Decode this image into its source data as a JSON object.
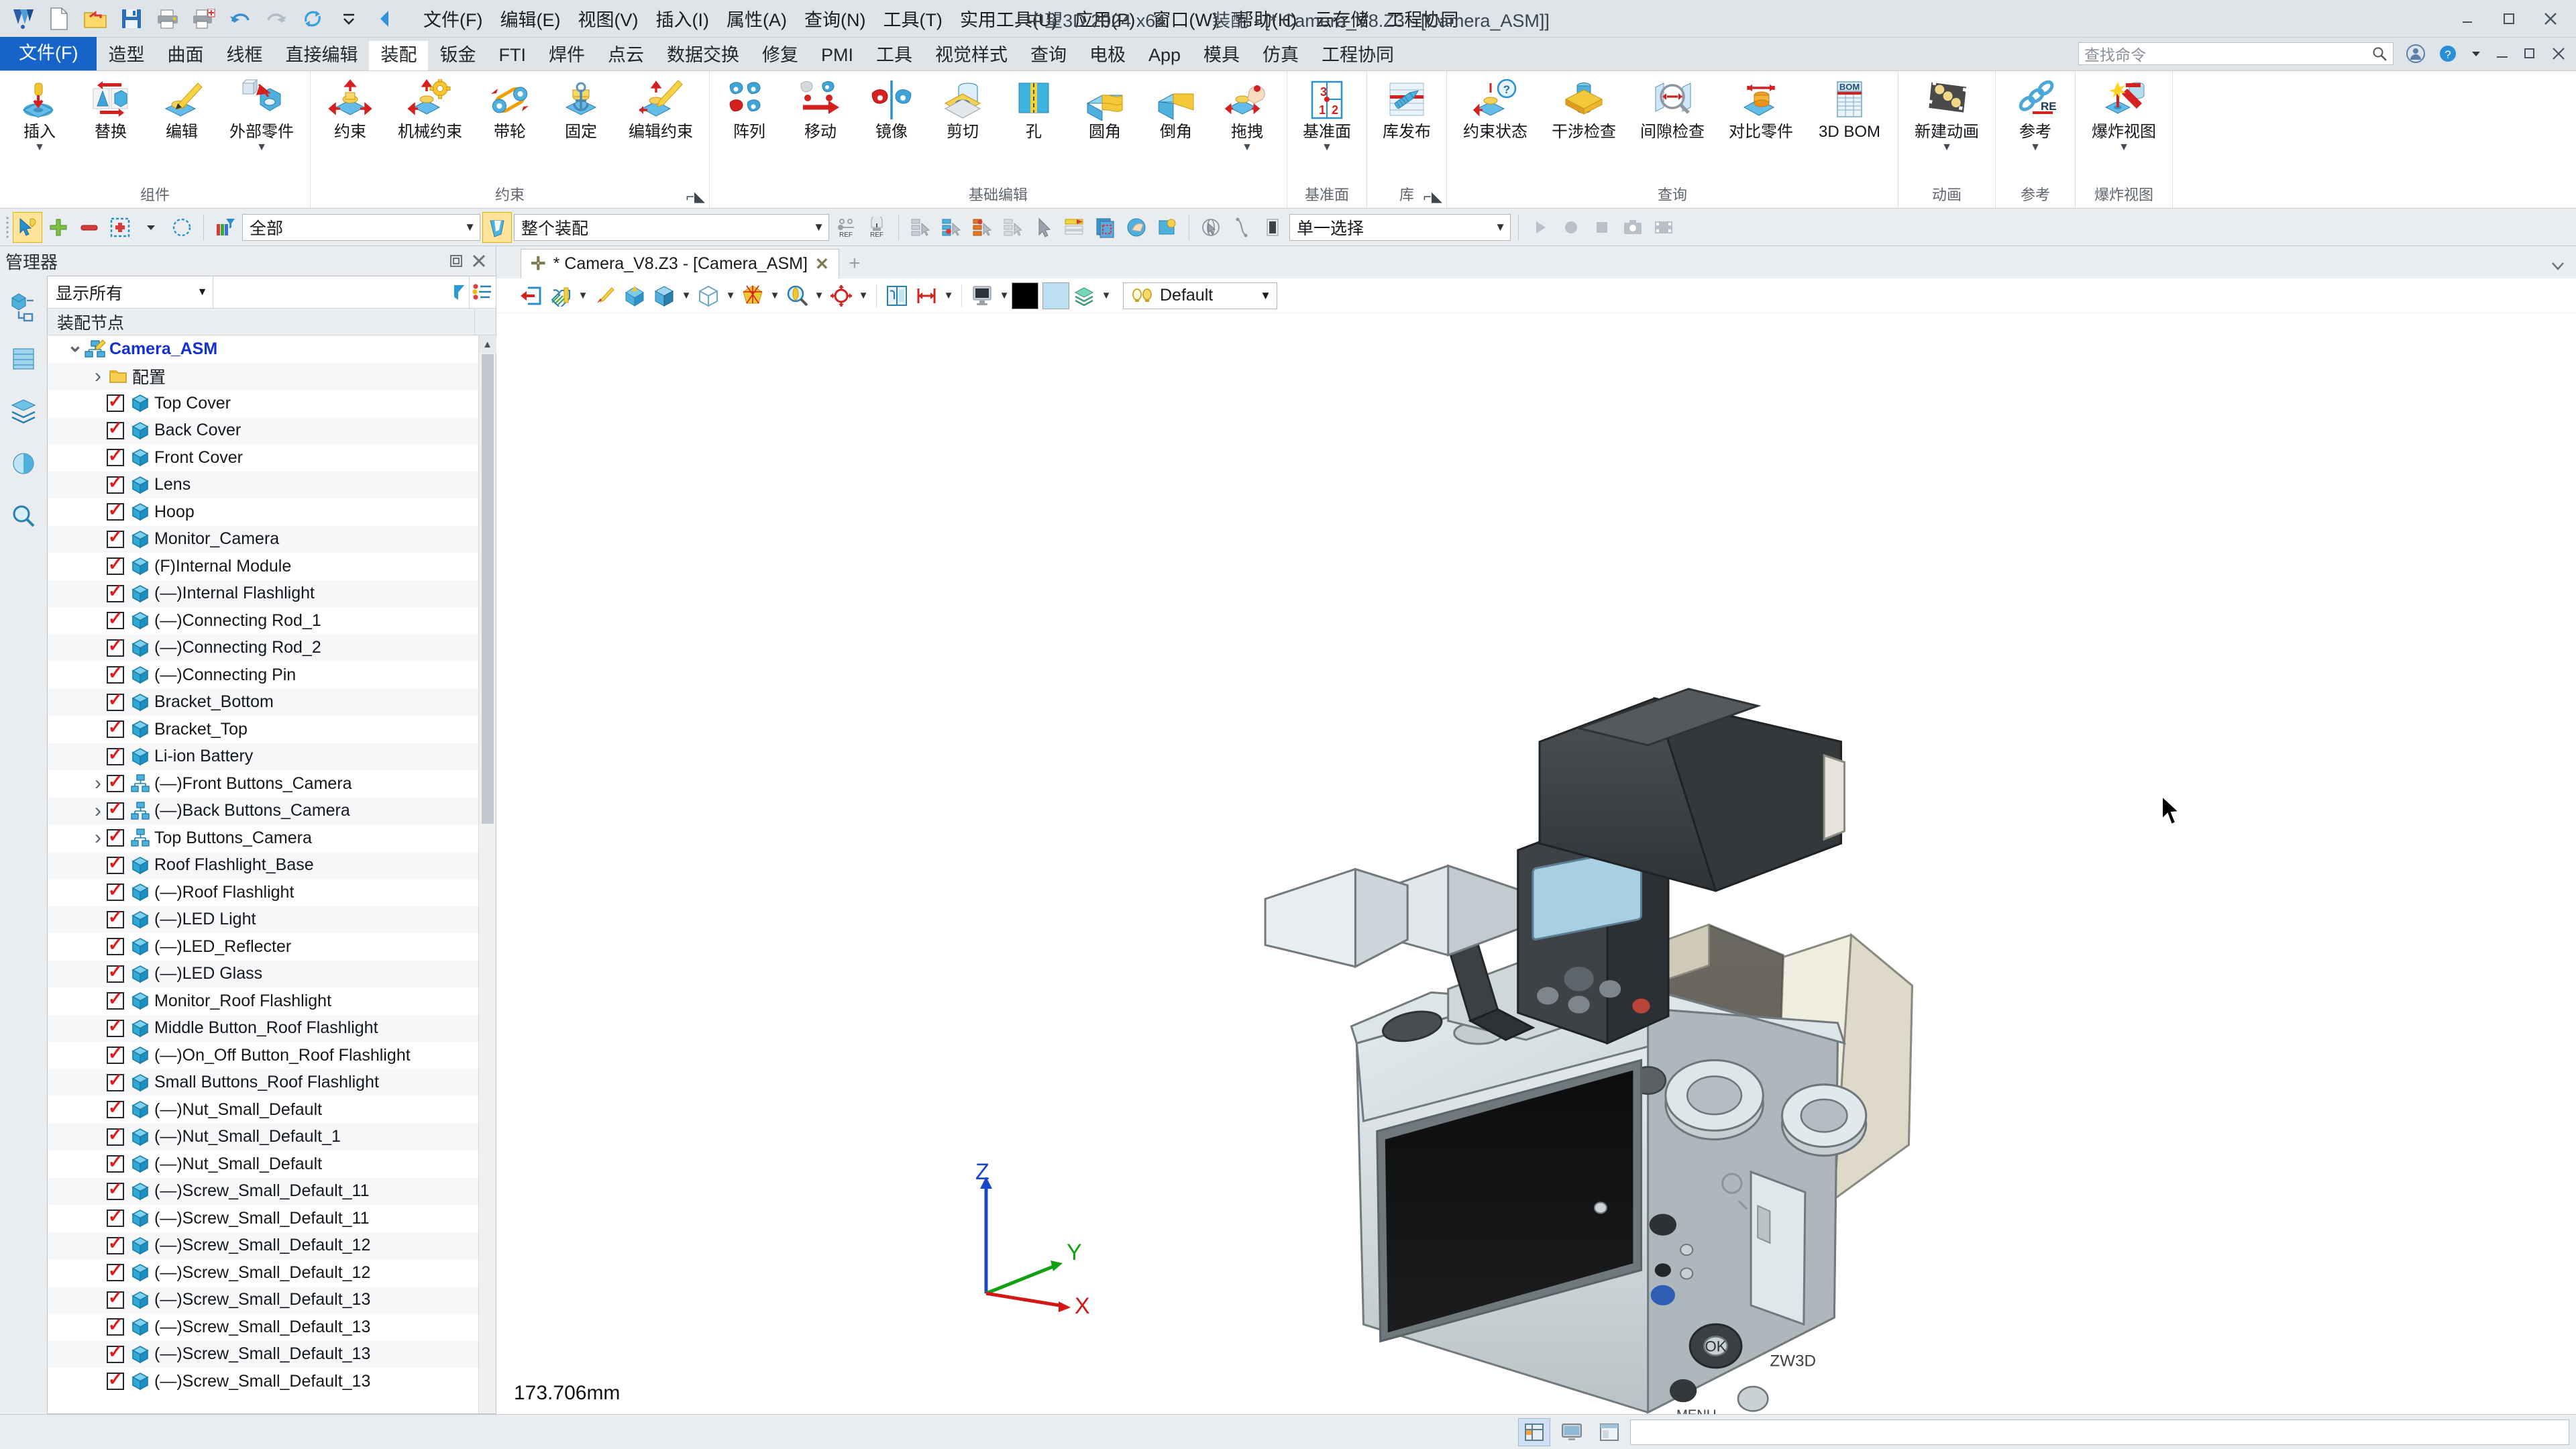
{
  "window": {
    "app_name": "中望3D 2024 x64",
    "title": "装配 - [* Camera_V8.Z3 - [Camera_ASM]]",
    "minimize": "—",
    "restore": "❐",
    "close": "✕"
  },
  "menubar": {
    "items": [
      "文件(F)",
      "编辑(E)",
      "视图(V)",
      "插入(I)",
      "属性(A)",
      "查询(N)",
      "工具(T)",
      "实用工具(U)",
      "应用(P)",
      "窗口(W)",
      "帮助(H)",
      "云存储",
      "工程协同"
    ]
  },
  "quick_access": {
    "items": [
      {
        "name": "app-logo-icon",
        "label": "中望3D"
      },
      {
        "name": "new-file-icon",
        "label": "新建"
      },
      {
        "name": "open-file-icon",
        "label": "打开"
      },
      {
        "name": "save-icon",
        "label": "保存"
      },
      {
        "name": "print-icon",
        "label": "打印"
      },
      {
        "name": "print-preview-icon",
        "label": "打印预览"
      },
      {
        "name": "undo-icon",
        "label": "撤销"
      },
      {
        "name": "redo-icon",
        "label": "重做"
      },
      {
        "name": "regen-icon",
        "label": "重生成"
      },
      {
        "name": "qat-more-icon",
        "label": "更多"
      },
      {
        "name": "collapse-ribbon-icon",
        "label": "折叠"
      }
    ]
  },
  "ribbon": {
    "tabs": [
      {
        "label": "文件(F)",
        "state": "file"
      },
      {
        "label": "造型",
        "state": "normal"
      },
      {
        "label": "曲面",
        "state": "normal"
      },
      {
        "label": "线框",
        "state": "normal"
      },
      {
        "label": "直接编辑",
        "state": "normal"
      },
      {
        "label": "装配",
        "state": "active"
      },
      {
        "label": "钣金",
        "state": "normal"
      },
      {
        "label": "FTI",
        "state": "normal"
      },
      {
        "label": "焊件",
        "state": "normal"
      },
      {
        "label": "点云",
        "state": "normal"
      },
      {
        "label": "数据交换",
        "state": "normal"
      },
      {
        "label": "修复",
        "state": "normal"
      },
      {
        "label": "PMI",
        "state": "normal"
      },
      {
        "label": "工具",
        "state": "normal"
      },
      {
        "label": "视觉样式",
        "state": "normal"
      },
      {
        "label": "查询",
        "state": "normal"
      },
      {
        "label": "电极",
        "state": "normal"
      },
      {
        "label": "App",
        "state": "normal"
      },
      {
        "label": "模具",
        "state": "normal"
      },
      {
        "label": "仿真",
        "state": "normal"
      },
      {
        "label": "工程协同",
        "state": "normal"
      }
    ],
    "search_placeholder": "查找命令",
    "groups": [
      {
        "label": "组件",
        "launcher": false,
        "buttons": [
          {
            "label": "插入",
            "icon": "insert-component-icon",
            "dropdown": true
          },
          {
            "label": "替换",
            "icon": "replace-component-icon",
            "dropdown": false
          },
          {
            "label": "编辑",
            "icon": "edit-component-icon",
            "dropdown": false
          },
          {
            "label": "外部零件",
            "icon": "external-part-icon",
            "dropdown": true
          }
        ]
      },
      {
        "label": "约束",
        "launcher": true,
        "buttons": [
          {
            "label": "约束",
            "icon": "constraint-icon",
            "dropdown": false
          },
          {
            "label": "机械约束",
            "icon": "mechanical-constraint-icon",
            "dropdown": false
          },
          {
            "label": "带轮",
            "icon": "belt-pulley-icon",
            "dropdown": false
          },
          {
            "label": "固定",
            "icon": "fix-icon",
            "dropdown": false
          },
          {
            "label": "编辑约束",
            "icon": "edit-constraint-icon",
            "dropdown": false
          }
        ]
      },
      {
        "label": "基础编辑",
        "launcher": false,
        "buttons": [
          {
            "label": "阵列",
            "icon": "pattern-icon",
            "dropdown": false
          },
          {
            "label": "移动",
            "icon": "move-icon",
            "dropdown": false
          },
          {
            "label": "镜像",
            "icon": "mirror-icon",
            "dropdown": false
          },
          {
            "label": "剪切",
            "icon": "trim-icon",
            "dropdown": false
          },
          {
            "label": "孔",
            "icon": "hole-icon",
            "dropdown": false
          },
          {
            "label": "圆角",
            "icon": "fillet-icon",
            "dropdown": false
          },
          {
            "label": "倒角",
            "icon": "chamfer-icon",
            "dropdown": false
          },
          {
            "label": "拖拽",
            "icon": "drag-icon",
            "dropdown": true
          }
        ]
      },
      {
        "label": "基准面",
        "launcher": false,
        "buttons": [
          {
            "label": "基准面",
            "icon": "datum-plane-icon",
            "dropdown": true
          }
        ]
      },
      {
        "label": "库",
        "launcher": true,
        "buttons": [
          {
            "label": "库发布",
            "icon": "library-publish-icon",
            "dropdown": false
          }
        ]
      },
      {
        "label": "查询",
        "launcher": false,
        "buttons": [
          {
            "label": "约束状态",
            "icon": "constraint-status-icon",
            "dropdown": false
          },
          {
            "label": "干涉检查",
            "icon": "interference-check-icon",
            "dropdown": false
          },
          {
            "label": "间隙检查",
            "icon": "clearance-check-icon",
            "dropdown": false
          },
          {
            "label": "对比零件",
            "icon": "compare-part-icon",
            "dropdown": false
          },
          {
            "label": "3D BOM",
            "icon": "bom-icon",
            "dropdown": false
          }
        ]
      },
      {
        "label": "动画",
        "launcher": false,
        "buttons": [
          {
            "label": "新建动画",
            "icon": "new-animation-icon",
            "dropdown": true
          }
        ]
      },
      {
        "label": "参考",
        "launcher": false,
        "buttons": [
          {
            "label": "参考",
            "icon": "reference-icon",
            "dropdown": true
          }
        ]
      },
      {
        "label": "爆炸视图",
        "launcher": false,
        "buttons": [
          {
            "label": "爆炸视图",
            "icon": "explode-view-icon",
            "dropdown": true
          }
        ]
      }
    ]
  },
  "toolbar2": {
    "buttons": [
      {
        "name": "select-highlight-icon",
        "state": "on"
      },
      {
        "name": "add-selection-icon",
        "state": "off"
      },
      {
        "name": "remove-selection-icon",
        "state": "off"
      },
      {
        "name": "select-box-icon",
        "state": "off"
      },
      {
        "name": "select-box-caret-icon",
        "state": "off"
      },
      {
        "name": "select-lasso-icon",
        "state": "off"
      },
      {
        "name": "filter-color-icon",
        "state": "off"
      }
    ],
    "filter_combo": {
      "value": "全部",
      "name": "selection-filter-combo"
    },
    "scope_combo": {
      "value": "整个装配",
      "name": "selection-scope-combo"
    },
    "right_buttons": [
      {
        "name": "ref-grid-icon"
      },
      {
        "name": "ref-clock-icon"
      },
      {
        "name": "list-select-1-icon"
      },
      {
        "name": "list-select-2-icon"
      },
      {
        "name": "list-select-3-icon"
      },
      {
        "name": "list-select-4-icon"
      },
      {
        "name": "pick-arrow-icon"
      },
      {
        "name": "stack-arrow-icon"
      },
      {
        "name": "copy-select-icon"
      },
      {
        "name": "hand-select-icon"
      },
      {
        "name": "gear-select-icon"
      },
      {
        "name": "sphere-pick-icon"
      },
      {
        "name": "curve-pick-icon"
      },
      {
        "name": "face-pick-icon"
      }
    ],
    "mode_combo": {
      "value": "单一选择",
      "name": "select-mode-combo"
    }
  },
  "manager": {
    "title": "管理器",
    "restore_btn": "❐",
    "close_btn": "✕",
    "rail": [
      {
        "name": "assembly-manager-icon",
        "state": "on"
      },
      {
        "name": "history-manager-icon",
        "state": "off"
      },
      {
        "name": "layer-manager-icon",
        "state": "off"
      },
      {
        "name": "visual-manager-icon",
        "state": "off"
      },
      {
        "name": "search-manager-icon",
        "state": "off"
      }
    ],
    "filter": {
      "value": "显示所有",
      "search_value": "",
      "search_placeholder": ""
    },
    "column_header": "装配节点",
    "tree": [
      {
        "label": "Camera_ASM",
        "icon": "assembly-icon",
        "expander": "v",
        "checkbox": false,
        "root": true,
        "indent": 0
      },
      {
        "label": "配置",
        "icon": "folder-icon",
        "expander": ">",
        "checkbox": false,
        "root": false,
        "indent": 1
      },
      {
        "label": "Top Cover",
        "icon": "part-icon",
        "expander": "",
        "checkbox": true,
        "indent": 1
      },
      {
        "label": "Back Cover",
        "icon": "part-icon",
        "expander": "",
        "checkbox": true,
        "indent": 1
      },
      {
        "label": "Front Cover",
        "icon": "part-icon",
        "expander": "",
        "checkbox": true,
        "indent": 1
      },
      {
        "label": "Lens",
        "icon": "part-icon",
        "expander": "",
        "checkbox": true,
        "indent": 1
      },
      {
        "label": "Hoop",
        "icon": "part-icon",
        "expander": "",
        "checkbox": true,
        "indent": 1
      },
      {
        "label": "Monitor_Camera",
        "icon": "part-icon",
        "expander": "",
        "checkbox": true,
        "indent": 1
      },
      {
        "label": "(F)Internal Module",
        "icon": "part-icon",
        "expander": "",
        "checkbox": true,
        "indent": 1
      },
      {
        "label": "(—)Internal Flashlight",
        "icon": "part-icon",
        "expander": "",
        "checkbox": true,
        "indent": 1
      },
      {
        "label": "(—)Connecting Rod_1",
        "icon": "part-icon",
        "expander": "",
        "checkbox": true,
        "indent": 1
      },
      {
        "label": "(—)Connecting Rod_2",
        "icon": "part-icon",
        "expander": "",
        "checkbox": true,
        "indent": 1
      },
      {
        "label": "(—)Connecting Pin",
        "icon": "part-icon",
        "expander": "",
        "checkbox": true,
        "indent": 1
      },
      {
        "label": "Bracket_Bottom",
        "icon": "part-icon",
        "expander": "",
        "checkbox": true,
        "indent": 1
      },
      {
        "label": "Bracket_Top",
        "icon": "part-icon",
        "expander": "",
        "checkbox": true,
        "indent": 1
      },
      {
        "label": "Li-ion Battery",
        "icon": "part-icon",
        "expander": "",
        "checkbox": true,
        "indent": 1
      },
      {
        "label": "(—)Front Buttons_Camera",
        "icon": "subassembly-icon",
        "expander": ">",
        "checkbox": true,
        "indent": 1
      },
      {
        "label": "(—)Back Buttons_Camera",
        "icon": "subassembly-icon",
        "expander": ">",
        "checkbox": true,
        "indent": 1
      },
      {
        "label": "Top Buttons_Camera",
        "icon": "subassembly-icon",
        "expander": ">",
        "checkbox": true,
        "indent": 1
      },
      {
        "label": "Roof Flashlight_Base",
        "icon": "part-icon",
        "expander": "",
        "checkbox": true,
        "indent": 1
      },
      {
        "label": "(—)Roof Flashlight",
        "icon": "part-icon",
        "expander": "",
        "checkbox": true,
        "indent": 1
      },
      {
        "label": "(—)LED Light",
        "icon": "part-icon",
        "expander": "",
        "checkbox": true,
        "indent": 1
      },
      {
        "label": "(—)LED_Reflecter",
        "icon": "part-icon",
        "expander": "",
        "checkbox": true,
        "indent": 1
      },
      {
        "label": "(—)LED Glass",
        "icon": "part-icon",
        "expander": "",
        "checkbox": true,
        "indent": 1
      },
      {
        "label": "Monitor_Roof Flashlight",
        "icon": "part-icon",
        "expander": "",
        "checkbox": true,
        "indent": 1
      },
      {
        "label": "Middle Button_Roof Flashlight",
        "icon": "part-icon",
        "expander": "",
        "checkbox": true,
        "indent": 1
      },
      {
        "label": "(—)On_Off Button_Roof Flashlight",
        "icon": "part-icon",
        "expander": "",
        "checkbox": true,
        "indent": 1
      },
      {
        "label": "Small Buttons_Roof Flashlight",
        "icon": "part-icon",
        "expander": "",
        "checkbox": true,
        "indent": 1
      },
      {
        "label": "(—)Nut_Small_Default",
        "icon": "part-icon",
        "expander": "",
        "checkbox": true,
        "indent": 1
      },
      {
        "label": "(—)Nut_Small_Default_1",
        "icon": "part-icon",
        "expander": "",
        "checkbox": true,
        "indent": 1
      },
      {
        "label": "(—)Nut_Small_Default",
        "icon": "part-icon",
        "expander": "",
        "checkbox": true,
        "indent": 1
      },
      {
        "label": "(—)Screw_Small_Default_11",
        "icon": "part-icon",
        "expander": "",
        "checkbox": true,
        "indent": 1
      },
      {
        "label": "(—)Screw_Small_Default_11",
        "icon": "part-icon",
        "expander": "",
        "checkbox": true,
        "indent": 1
      },
      {
        "label": "(—)Screw_Small_Default_12",
        "icon": "part-icon",
        "expander": "",
        "checkbox": true,
        "indent": 1
      },
      {
        "label": "(—)Screw_Small_Default_12",
        "icon": "part-icon",
        "expander": "",
        "checkbox": true,
        "indent": 1
      },
      {
        "label": "(—)Screw_Small_Default_13",
        "icon": "part-icon",
        "expander": "",
        "checkbox": true,
        "indent": 1
      },
      {
        "label": "(—)Screw_Small_Default_13",
        "icon": "part-icon",
        "expander": "",
        "checkbox": true,
        "indent": 1
      },
      {
        "label": "(—)Screw_Small_Default_13",
        "icon": "part-icon",
        "expander": "",
        "checkbox": true,
        "indent": 1
      },
      {
        "label": "(—)Screw_Small_Default_13",
        "icon": "part-icon",
        "expander": "",
        "checkbox": true,
        "indent": 1
      }
    ]
  },
  "document_tabs": {
    "tabs": [
      {
        "label": "* Camera_V8.Z3 - [Camera_ASM]",
        "close": "✕",
        "plus": "✛"
      }
    ],
    "add_label": "+"
  },
  "view_toolbar": {
    "buttons": [
      {
        "name": "exit-icon",
        "dropdown": false
      },
      {
        "name": "section-icon",
        "dropdown": true
      },
      {
        "name": "paint-icon",
        "dropdown": false
      },
      {
        "name": "orient-view-icon",
        "dropdown": false
      },
      {
        "name": "standard-view-icon",
        "dropdown": true
      },
      {
        "name": "wireframe-view-icon",
        "dropdown": true
      },
      {
        "name": "render-style-icon",
        "dropdown": true
      },
      {
        "name": "zoom-all-icon",
        "dropdown": true
      },
      {
        "name": "rotate-view-icon",
        "dropdown": true
      },
      {
        "name": "viewport-layout-icon",
        "dropdown": false
      },
      {
        "name": "measure-icon",
        "dropdown": true
      },
      {
        "name": "monitor-display-icon",
        "dropdown": true
      }
    ],
    "swatch_black": "#000000",
    "swatch_blue": "#bcdff1",
    "layers_icon": "layers-icon",
    "config_combo": {
      "value": "Default",
      "icon": "bulb-icon"
    }
  },
  "viewport": {
    "dimension_text": "173.706mm",
    "triad": {
      "x": "X",
      "y": "Y",
      "z": "Z"
    },
    "background": "#ffffff",
    "model_name": "Camera_ASM"
  },
  "statusbar": {
    "message": "",
    "icons": [
      {
        "name": "status-grid-icon",
        "state": "on"
      },
      {
        "name": "status-monitor-icon",
        "state": "off"
      },
      {
        "name": "status-window-icon",
        "state": "off"
      }
    ],
    "field_value": ""
  }
}
